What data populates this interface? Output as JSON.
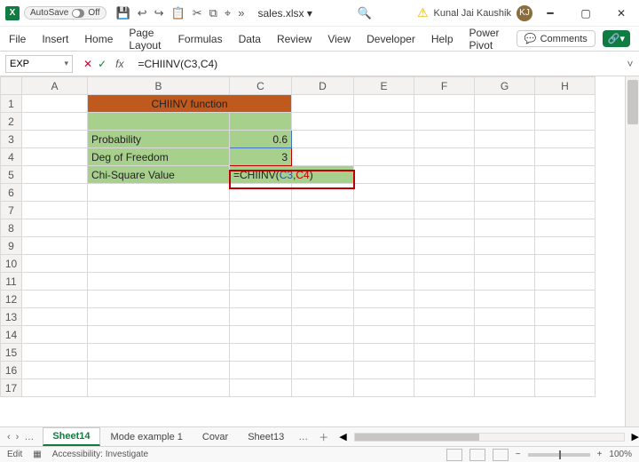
{
  "titlebar": {
    "autosave_label": "AutoSave",
    "autosave_state": "Off",
    "filename": "sales.xlsx ▾",
    "user_name": "Kunal Jai Kaushik",
    "user_initials": "KJ"
  },
  "ribbon": {
    "tabs": [
      "File",
      "Insert",
      "Home",
      "Page Layout",
      "Formulas",
      "Data",
      "Review",
      "View",
      "Developer",
      "Help",
      "Power Pivot"
    ],
    "comments_label": "Comments"
  },
  "formula_bar": {
    "name_box": "EXP",
    "formula": "=CHIINV(C3,C4)"
  },
  "columns": [
    "A",
    "B",
    "C",
    "D",
    "E",
    "F",
    "G",
    "H"
  ],
  "rows": [
    "1",
    "2",
    "3",
    "4",
    "5",
    "6",
    "7",
    "8",
    "9",
    "10",
    "11",
    "12",
    "13",
    "14",
    "15",
    "16",
    "17"
  ],
  "cells": {
    "title": "CHIINV function",
    "b3": "Probability",
    "c3": "0.6",
    "b4": "Deg of Freedom",
    "c4": "3",
    "b5": "Chi-Square Value",
    "c5_prefix": "=CHIINV(",
    "c5_ref1": "C3",
    "c5_comma": ",",
    "c5_ref2": "C4",
    "c5_suffix": ")"
  },
  "sheet_tabs": {
    "active": "Sheet14",
    "others": [
      "Mode example 1",
      "Covar",
      "Sheet13"
    ]
  },
  "statusbar": {
    "mode": "Edit",
    "accessibility": "Accessibility: Investigate",
    "zoom": "100%"
  },
  "chart_data": {
    "type": "table",
    "title": "CHIINV function",
    "rows": [
      {
        "label": "Probability",
        "value": 0.6
      },
      {
        "label": "Deg of Freedom",
        "value": 3
      },
      {
        "label": "Chi-Square Value",
        "value": "=CHIINV(C3,C4)"
      }
    ]
  }
}
